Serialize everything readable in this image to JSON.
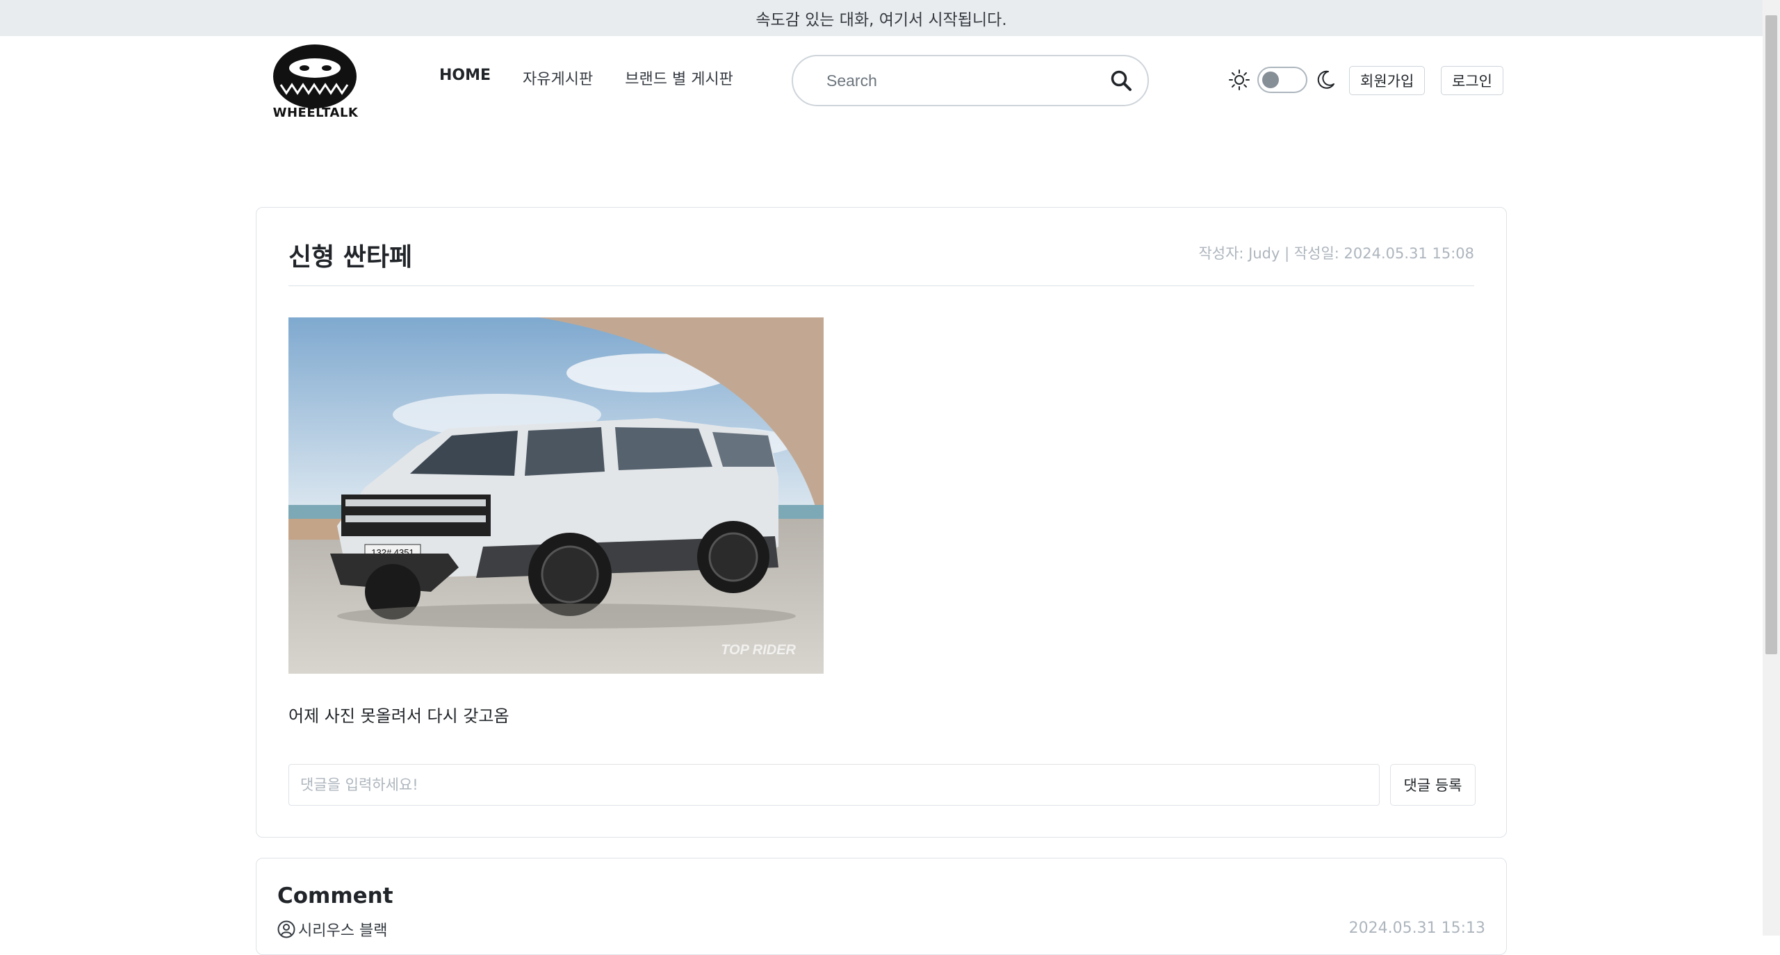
{
  "announcement": "속도감 있는 대화, 여기서 시작됩니다.",
  "brand": {
    "name": "WHEELTALK"
  },
  "nav": {
    "items": [
      {
        "label": "HOME",
        "active": true
      },
      {
        "label": "자유게시판",
        "active": false
      },
      {
        "label": "브랜드 별 게시판",
        "active": false
      }
    ]
  },
  "search": {
    "placeholder": "Search",
    "value": ""
  },
  "theme": {
    "dark_mode": false
  },
  "auth": {
    "signup_label": "회원가입",
    "login_label": "로그인"
  },
  "post": {
    "title": "신형 싼타페",
    "meta": "작성자: Judy | 작성일: 2024.05.31 15:08",
    "image_watermark": "TOP RIDER",
    "plate_text": "132# 4351",
    "body": "어제 사진 못올려서 다시 갖고옴"
  },
  "comment_form": {
    "placeholder": "댓글을 입력하세요!",
    "submit_label": "댓글 등록"
  },
  "comments": {
    "heading": "Comment",
    "items": [
      {
        "author": "시리우스 블랙",
        "date": "2024.05.31 15:13"
      }
    ]
  },
  "colors": {
    "topbar_bg": "#e9ecef",
    "border": "#dee2e6",
    "muted_text": "#adb5bd",
    "car_body": "#dfe3e6",
    "sky": "#9fc1dc"
  }
}
